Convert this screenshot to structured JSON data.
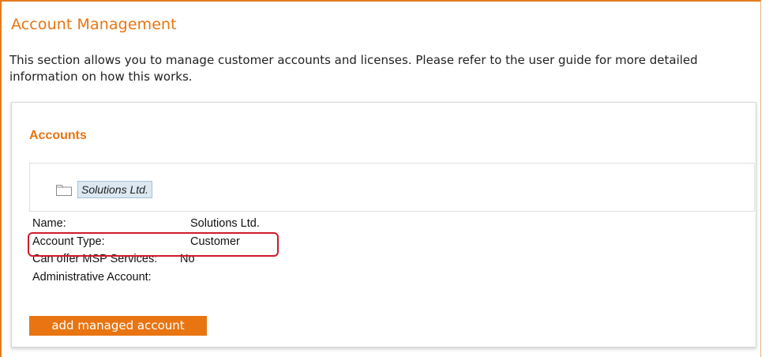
{
  "page": {
    "title": "Account Management",
    "intro": "This section allows you to manage customer accounts and licenses. Please refer to the user guide for more detailed information on how this works."
  },
  "accounts_panel": {
    "title": "Accounts",
    "tree": {
      "selected_node": "Solutions Ltd.",
      "icon": "folder-icon"
    },
    "details": {
      "name_label": "Name:",
      "name_value": "Solutions Ltd.",
      "type_label": "Account Type:",
      "type_value": "Customer",
      "msp_label": "Can offer MSP Services:",
      "msp_value": "No",
      "admin_label": "Administrative Account:",
      "admin_value": ""
    },
    "add_button_label": "add managed account"
  },
  "colors": {
    "accent": "#e87511",
    "highlight": "#d11a2a"
  }
}
